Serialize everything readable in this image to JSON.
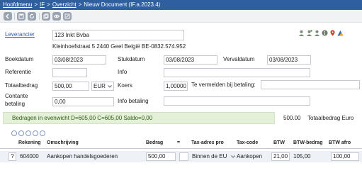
{
  "breadcrumb": {
    "items": [
      "Hoofdmenu",
      "IF",
      "Overzicht",
      "Nieuw Document (IF.a.2023.4)"
    ],
    "separator": ">"
  },
  "toolbar": {
    "buttons": [
      "back-icon",
      "save-icon",
      "refresh-icon",
      "copy-icon",
      "preview-icon",
      "edit-icon"
    ]
  },
  "form": {
    "leverancier": {
      "label": "Leverancier",
      "value": "123 Inkt Bvba"
    },
    "address": "Kleinhoefstraat 5 2440 Geel België BE-0832.574.952",
    "boekdatum": {
      "label": "Boekdatum",
      "value": "03/08/2023"
    },
    "stukdatum": {
      "label": "Stukdatum",
      "value": "03/08/2023"
    },
    "vervaldatum": {
      "label": "Vervaldatum",
      "value": "03/08/2023"
    },
    "referentie": {
      "label": "Referentie",
      "value": ""
    },
    "info": {
      "label": "Info",
      "value": ""
    },
    "totaalbedrag": {
      "label": "Totaalbedrag",
      "value": "500,00",
      "currency": "EUR"
    },
    "koers": {
      "label": "Koers",
      "value": "1,00000"
    },
    "te_vermelden": {
      "label": "Te vermelden bij betaling:",
      "value": ""
    },
    "contante": {
      "label_line1": "Contante",
      "label_line2": "betaling",
      "value": "0,00"
    },
    "info_betaling": {
      "label": "Info betaling",
      "value": ""
    }
  },
  "summary": {
    "notice": "Bedragen in evenwicht D=605,00 C=605,00 Saldo=0,00",
    "total_amount": "500.00",
    "total_label": "Totaalbedrag Euro"
  },
  "grid": {
    "columns": [
      "Rekening",
      "Omschrijving",
      "Bedrag",
      "=",
      "Tax-adres pro",
      "Tax-code",
      "BTW",
      "BTW-bedrag",
      "BTW afro"
    ],
    "rows": [
      {
        "help": "?",
        "rekening": "604000",
        "omschrijving": "Aankopen handelsgoederen",
        "bedrag": "500,00",
        "tax_adres": "Binnen de EU",
        "tax_code": "Aankopen",
        "btw": "21,00",
        "btw_bedrag": "105,00",
        "btw_afro": "100,00"
      }
    ]
  },
  "colors": {
    "topbar": "#2f5f9e",
    "link": "#2a5db0",
    "notice_bg": "#e5f0d8",
    "notice_text": "#2b5a12"
  }
}
